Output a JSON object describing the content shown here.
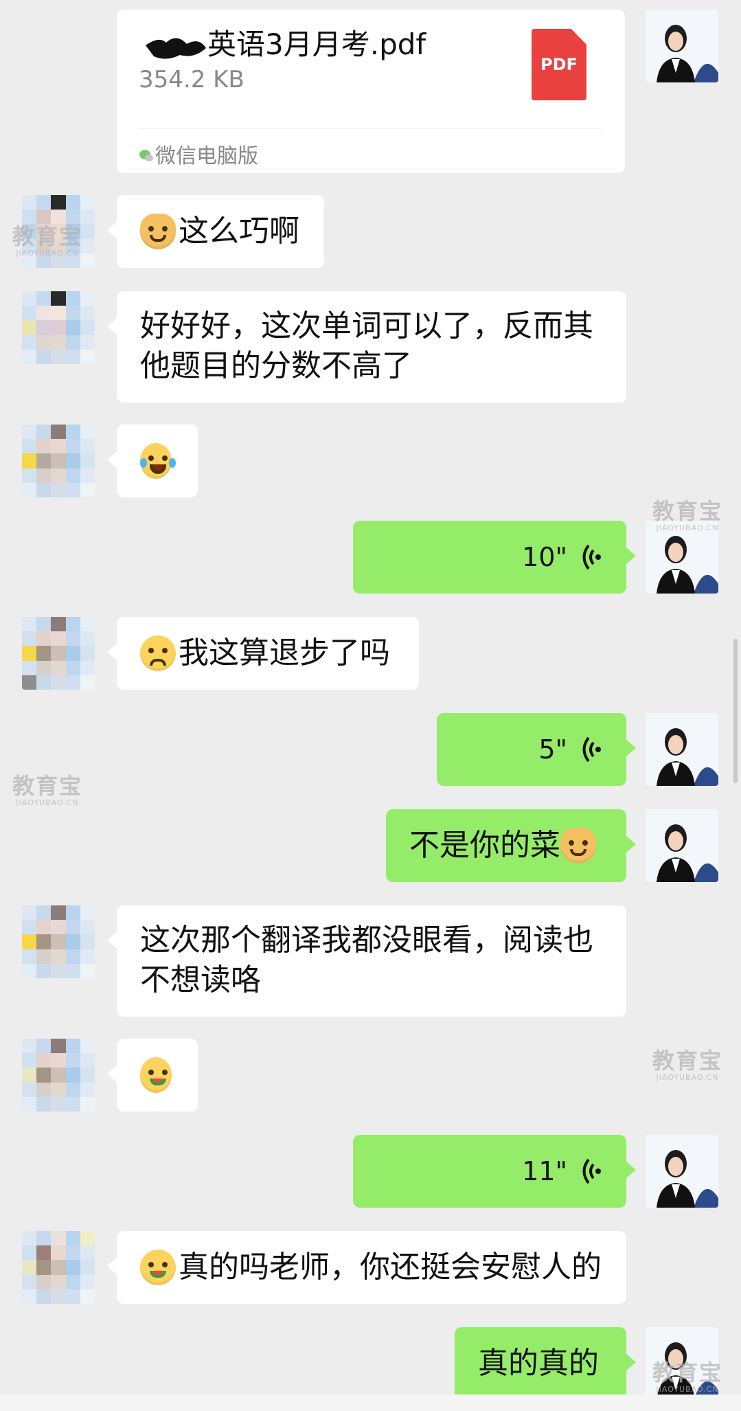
{
  "file": {
    "name": "英语3月月考.pdf",
    "size": "354.2 KB",
    "type_badge": "PDF",
    "source": "微信电脑版"
  },
  "messages": [
    {
      "side": "left",
      "emoji": "cat",
      "text": "这么巧啊"
    },
    {
      "side": "left",
      "text": "好好好，这次单词可以了，反而其他题目的分数不高了"
    },
    {
      "side": "left",
      "emoji": "lol",
      "text": ""
    },
    {
      "side": "right",
      "voice": "10\""
    },
    {
      "side": "left",
      "emoji": "sad",
      "text": "我这算退步了吗"
    },
    {
      "side": "right",
      "voice": "5\""
    },
    {
      "side": "right",
      "text": "不是你的菜",
      "emoji_after": "cat"
    },
    {
      "side": "left",
      "text": "这次那个翻译我都没眼看，阅读也不想读咯"
    },
    {
      "side": "left",
      "emoji": "eat",
      "text": ""
    },
    {
      "side": "right",
      "voice": "11\""
    },
    {
      "side": "left",
      "emoji": "eat",
      "text": "真的吗老师，你还挺会安慰人的"
    },
    {
      "side": "right",
      "text": "真的真的"
    }
  ],
  "watermark": {
    "brand": "教育宝",
    "domain": "JIAOYUBAO.CN"
  },
  "colors": {
    "background": "#ededed",
    "self_bubble": "#95ec69",
    "other_bubble": "#ffffff",
    "pdf": "#e94040"
  }
}
